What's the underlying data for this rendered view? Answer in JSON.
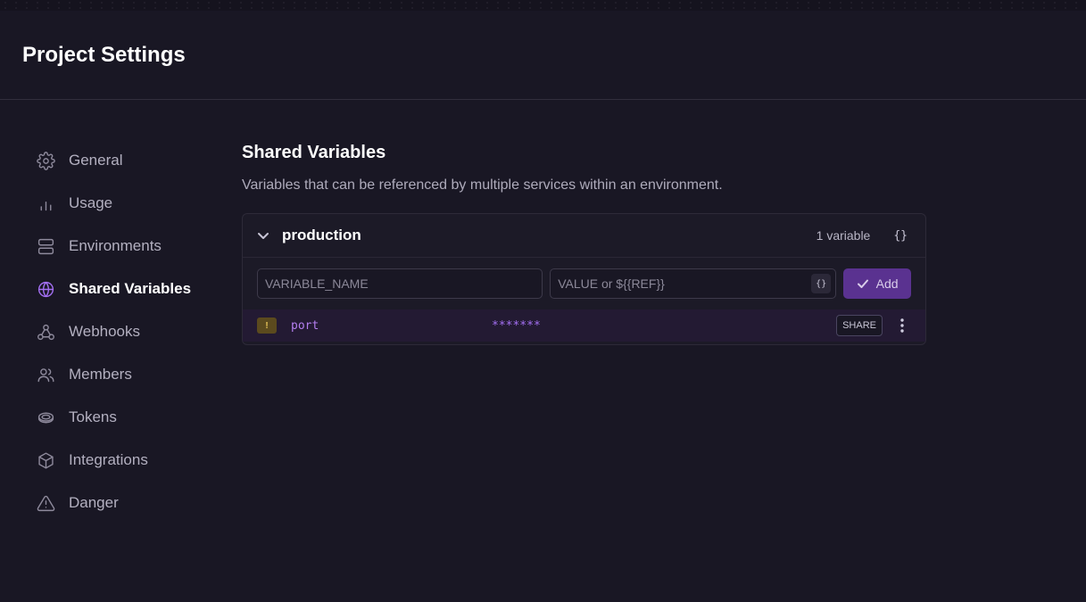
{
  "page": {
    "title": "Project Settings"
  },
  "sidebar": {
    "items": [
      {
        "label": "General",
        "icon": "gear-icon"
      },
      {
        "label": "Usage",
        "icon": "bar-chart-icon"
      },
      {
        "label": "Environments",
        "icon": "server-icon"
      },
      {
        "label": "Shared Variables",
        "icon": "globe-icon",
        "active": true
      },
      {
        "label": "Webhooks",
        "icon": "webhook-icon"
      },
      {
        "label": "Members",
        "icon": "users-icon"
      },
      {
        "label": "Tokens",
        "icon": "token-icon"
      },
      {
        "label": "Integrations",
        "icon": "box-icon"
      },
      {
        "label": "Danger",
        "icon": "warning-icon"
      }
    ]
  },
  "main": {
    "title": "Shared Variables",
    "description": "Variables that can be referenced by multiple services within an environment.",
    "environment": {
      "name": "production",
      "count_label": "1 variable",
      "raw_editor_label": "{}",
      "name_placeholder": "VARIABLE_NAME",
      "value_placeholder": "VALUE or ${{REF}}",
      "ref_button_label": "{}",
      "add_label": "Add",
      "variables": [
        {
          "badge": "!",
          "name": "port",
          "value": "*******",
          "share_label": "SHARE"
        }
      ]
    }
  },
  "colors": {
    "background": "#191724",
    "accent": "#a36ff2",
    "add_button": "#5a3290",
    "row_highlight": "#231a33",
    "warning_badge": "#5b4a1e"
  }
}
